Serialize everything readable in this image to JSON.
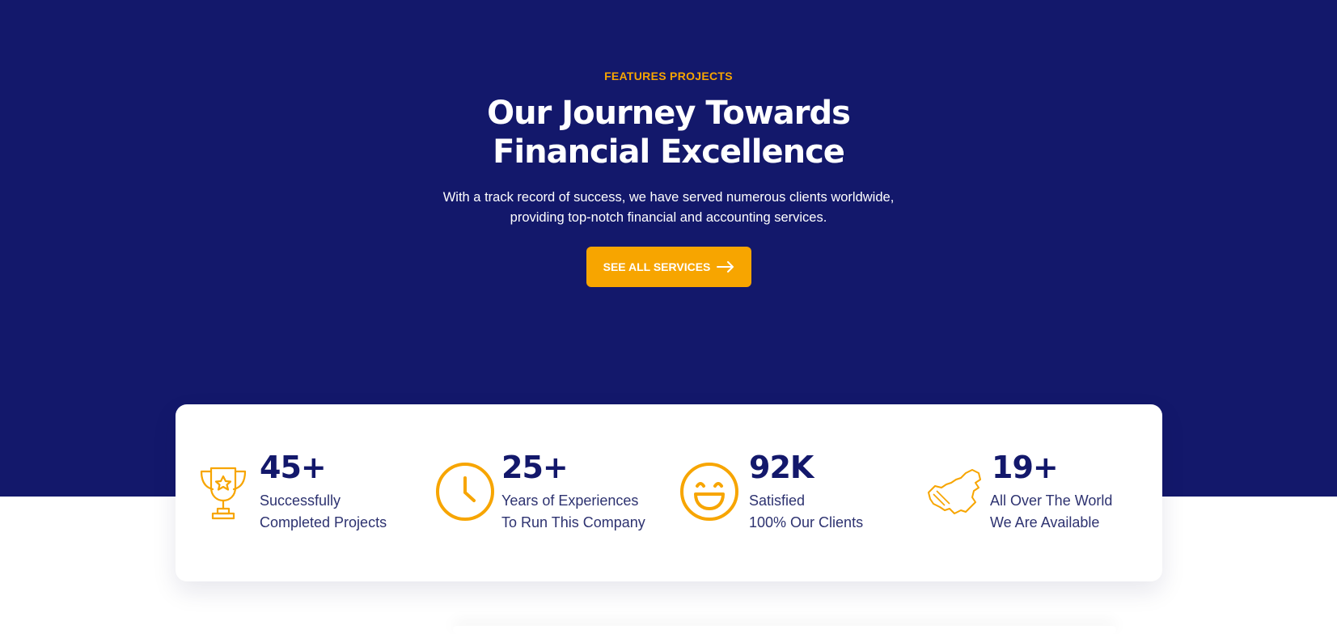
{
  "hero": {
    "eyebrow": "FEATURES PROJECTS",
    "title_line1": "Our Journey Towards",
    "title_line2": "Financial Excellence",
    "subtitle_line1": "With a track record of success, we have served numerous clients worldwide,",
    "subtitle_line2": "providing top-notch financial and accounting services.",
    "cta_label": "SEE ALL SERVICES",
    "cta_icon": "arrow-right-icon"
  },
  "stats": [
    {
      "value": "45+",
      "line1": "Successfully",
      "line2": "Completed Projects",
      "icon": "trophy-icon"
    },
    {
      "value": "25+",
      "line1": "Years of Experiences",
      "line2": "To Run This Company",
      "icon": "clock-icon"
    },
    {
      "value": "92K",
      "line1": "Satisfied",
      "line2": "100% Our Clients",
      "icon": "smile-icon"
    },
    {
      "value": "19+",
      "line1": "All Over The World",
      "line2": "We Are Available",
      "icon": "map-icon"
    }
  ],
  "colors": {
    "navy": "#13186b",
    "accent": "#f7a500",
    "white": "#ffffff"
  }
}
